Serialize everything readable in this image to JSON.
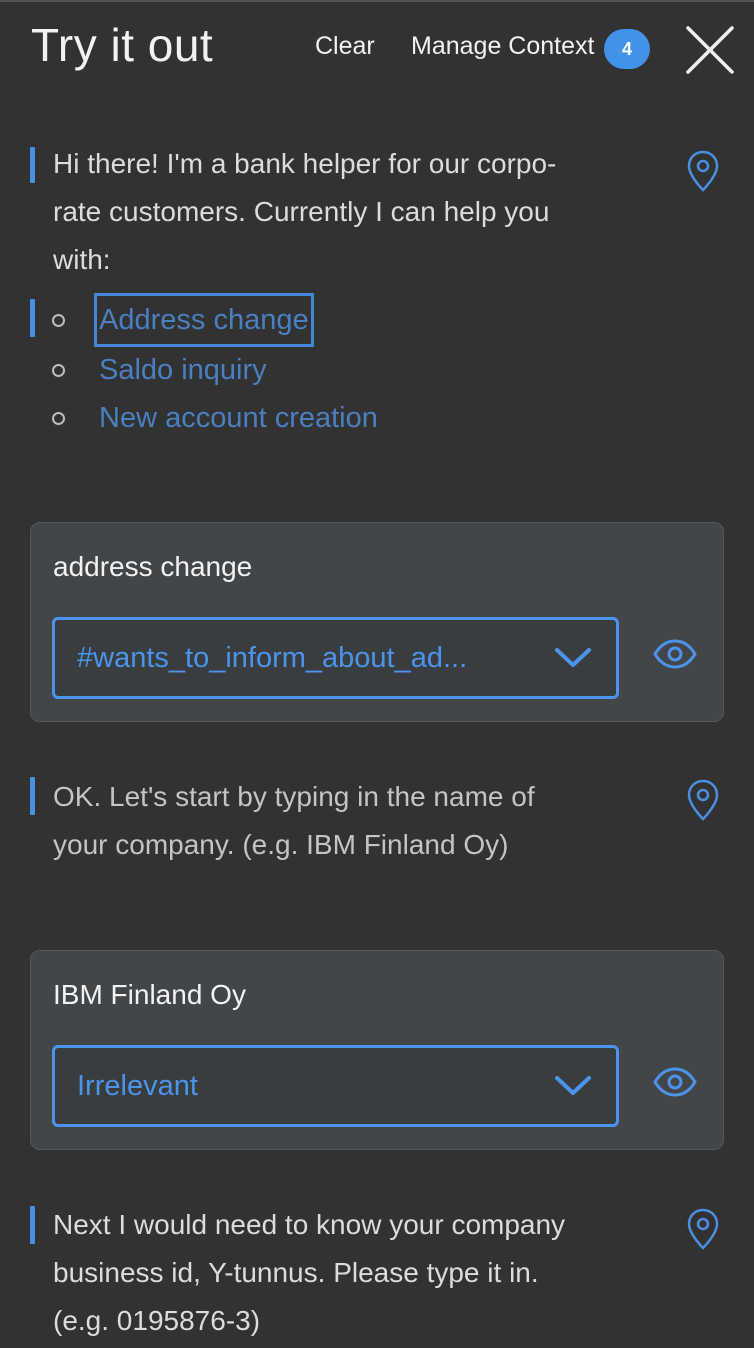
{
  "header": {
    "title": "Try it out",
    "clear_label": "Clear",
    "manage_context_label": "Manage Context",
    "context_count": "4",
    "close_icon": "close-icon"
  },
  "conversation": {
    "welcome": {
      "text_line1": "Hi there! I'm a bank helper for our corpo-",
      "text_line2": "rate customers. Currently I can help you",
      "text_line3": "with:",
      "options": [
        "Address change",
        "Saldo inquiry",
        "New account creation"
      ]
    },
    "user1": {
      "text": "address change",
      "intent": "#wants_to_inform_about_ad..."
    },
    "bot2": {
      "line1": "OK. Let's start by typing in the name of",
      "line2": "your company. (e.g. IBM Finland Oy)"
    },
    "user2": {
      "text": "IBM Finland Oy",
      "intent": "Irrelevant"
    },
    "bot3": {
      "line1": "Next I would need to know your company",
      "line2": "business id, Y-tunnus. Please type it in.",
      "line3": "(e.g. 0195876-3)"
    }
  },
  "icons": {
    "pin": "map-pin-icon",
    "eye": "eye-icon",
    "chevron": "chevron-down-icon"
  },
  "colors": {
    "background": "#323232",
    "accent": "#4a94ec",
    "link": "#4a7fc0",
    "badge": "#4192e8",
    "card": "#434649"
  }
}
